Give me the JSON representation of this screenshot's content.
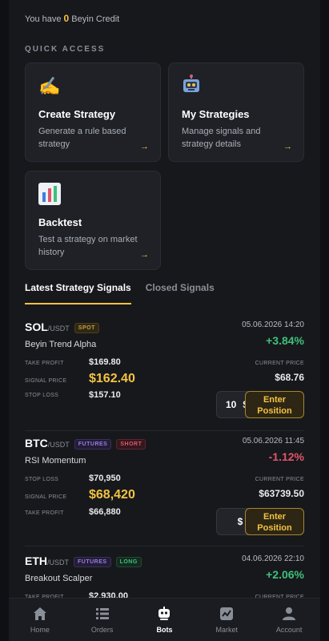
{
  "header": {
    "credit_prefix": "You have",
    "credit_value": "0",
    "credit_suffix": "Beyin Credit"
  },
  "quick_access": {
    "title": "QUICK ACCESS",
    "cards": [
      {
        "icon": "writing-hand-icon",
        "title": "Create Strategy",
        "desc": "Generate a rule based strategy",
        "arrow": "→"
      },
      {
        "icon": "robot-icon",
        "title": "My Strategies",
        "desc": "Manage signals and strategy details",
        "arrow": "→"
      },
      {
        "icon": "bar-chart-icon",
        "title": "Backtest",
        "desc": "Test a strategy on market history",
        "arrow": "→"
      }
    ]
  },
  "tabs": [
    {
      "label": "Latest Strategy Signals",
      "active": true
    },
    {
      "label": "Closed Signals",
      "active": false
    }
  ],
  "labels": {
    "take_profit": "TAKE PROFIT",
    "signal_price": "SIGNAL PRICE",
    "stop_loss": "STOP LOSS",
    "current_price": "CURRENT PRICE",
    "enter_position": "Enter Position",
    "currency": "$"
  },
  "signals": [
    {
      "base": "SOL",
      "quote": "/USDT",
      "badges": [
        "SPOT"
      ],
      "strategy": "Beyin Trend Alpha",
      "date": "05.06.2026 14:20",
      "change": "+3.84%",
      "direction": "up",
      "rows": [
        {
          "label": "TAKE PROFIT",
          "value": "$169.80"
        },
        {
          "label": "SIGNAL PRICE",
          "value": "$162.40"
        },
        {
          "label": "STOP LOSS",
          "value": "$157.10"
        }
      ],
      "current_price": "$68.76",
      "amount": "10"
    },
    {
      "base": "BTC",
      "quote": "/USDT",
      "badges": [
        "FUTURES",
        "SHORT"
      ],
      "strategy": "RSI Momentum",
      "date": "05.06.2026 11:45",
      "change": "-1.12%",
      "direction": "down",
      "rows": [
        {
          "label": "STOP LOSS",
          "value": "$70,950"
        },
        {
          "label": "SIGNAL PRICE",
          "value": "$68,420"
        },
        {
          "label": "TAKE PROFIT",
          "value": "$66,880"
        }
      ],
      "current_price": "$63739.50",
      "amount": ""
    },
    {
      "base": "ETH",
      "quote": "/USDT",
      "badges": [
        "FUTURES",
        "LONG"
      ],
      "strategy": "Breakout Scalper",
      "date": "04.06.2026 22:10",
      "change": "+2.06%",
      "direction": "up",
      "rows": [
        {
          "label": "TAKE PROFIT",
          "value": "$2,930.00"
        }
      ],
      "current_price": "",
      "amount": ""
    }
  ],
  "nav": [
    {
      "icon": "home-icon",
      "label": "Home",
      "active": false
    },
    {
      "icon": "orders-icon",
      "label": "Orders",
      "active": false
    },
    {
      "icon": "bot-icon",
      "label": "Bots",
      "active": true
    },
    {
      "icon": "market-icon",
      "label": "Market",
      "active": false
    },
    {
      "icon": "account-icon",
      "label": "Account",
      "active": false
    }
  ],
  "colors": {
    "accent": "#f3c341",
    "positive": "#3fc07a",
    "negative": "#e0556a",
    "background": "#17181c",
    "card": "#1f2127"
  }
}
